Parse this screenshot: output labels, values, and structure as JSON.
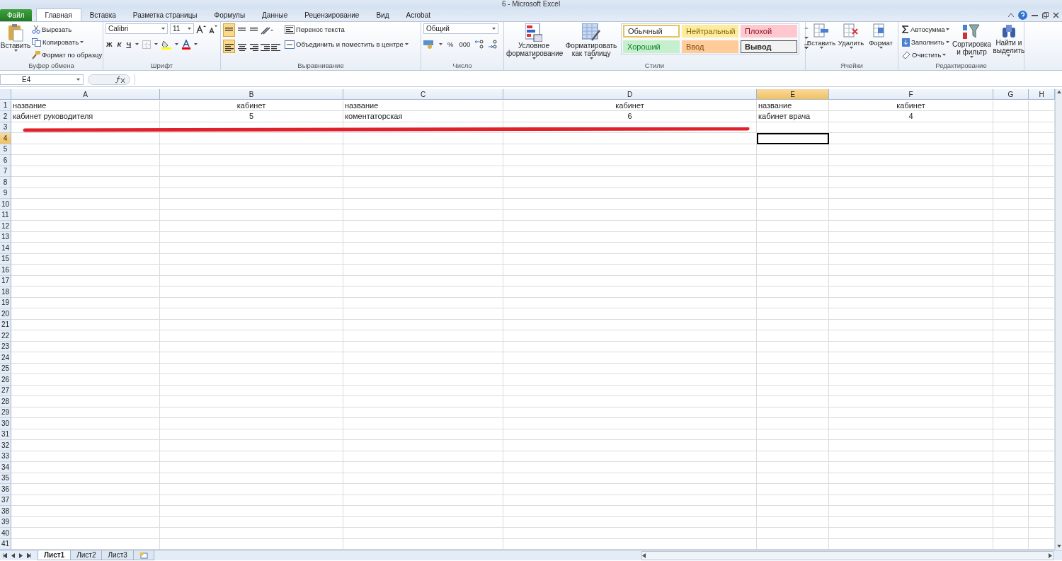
{
  "window": {
    "title": "6  -  Microsoft Excel"
  },
  "ribbon_tabs": [
    {
      "label": "Файл",
      "kind": "file",
      "selected": false
    },
    {
      "label": "Главная",
      "kind": "tab",
      "selected": true
    },
    {
      "label": "Вставка",
      "kind": "tab",
      "selected": false
    },
    {
      "label": "Разметка страницы",
      "kind": "tab",
      "selected": false
    },
    {
      "label": "Формулы",
      "kind": "tab",
      "selected": false
    },
    {
      "label": "Данные",
      "kind": "tab",
      "selected": false
    },
    {
      "label": "Рецензирование",
      "kind": "tab",
      "selected": false
    },
    {
      "label": "Вид",
      "kind": "tab",
      "selected": false
    },
    {
      "label": "Acrobat",
      "kind": "tab",
      "selected": false
    }
  ],
  "clipboard": {
    "paste": "Вставить",
    "cut": "Вырезать",
    "copy": "Копировать",
    "format_painter": "Формат по образцу",
    "label": "Буфер обмена"
  },
  "font": {
    "name": "Calibri",
    "size": "11",
    "bold": "Ж",
    "italic": "К",
    "underline": "Ч",
    "label": "Шрифт"
  },
  "alignment": {
    "vertical": [
      {
        "selected": true
      },
      {
        "selected": false
      },
      {
        "selected": false
      }
    ],
    "horizontal": [
      {
        "selected": true
      },
      {
        "selected": false
      },
      {
        "selected": false
      }
    ],
    "wrap": "Перенос текста",
    "merge": "Объединить и поместить в центре",
    "label": "Выравнивание"
  },
  "number": {
    "format": "Общий",
    "percent": "%",
    "thousands": "000",
    "label": "Число"
  },
  "styles": {
    "conditional": "Условное форматирование",
    "as_table": "Форматировать как таблицу",
    "presets": [
      {
        "label": "Обычный",
        "color": "#ffffff",
        "selected": true
      },
      {
        "label": "Нейтральный",
        "color": "#ffeb9c",
        "selected": false
      },
      {
        "label": "Плохой",
        "color": "#ffc7ce",
        "selected": false
      },
      {
        "label": "Хороший",
        "color": "#c6efce",
        "selected": false
      },
      {
        "label": "Ввод",
        "color": "#ffcc99",
        "selected": false
      },
      {
        "label": "Вывод",
        "color": "#f2f2f2",
        "selected": false
      }
    ],
    "label": "Стили"
  },
  "cells": {
    "buttons": [
      "Вставить",
      "Удалить",
      "Формат"
    ],
    "label": "Ячейки"
  },
  "editing": {
    "autosum": "Автосумма",
    "fill": "Заполнить",
    "clear": "Очистить",
    "sort": "Сортировка и фильтр",
    "find": "Найти и выделить",
    "label": "Редактирование"
  },
  "name_box": "E4",
  "columns": [
    {
      "label": "A",
      "selected": false
    },
    {
      "label": "B",
      "selected": false
    },
    {
      "label": "C",
      "selected": false
    },
    {
      "label": "D",
      "selected": false
    },
    {
      "label": "E",
      "selected": true
    },
    {
      "label": "F",
      "selected": false
    },
    {
      "label": "G",
      "selected": false
    },
    {
      "label": "H",
      "selected": false
    }
  ],
  "rows": [
    {
      "label": "1",
      "selected": false,
      "cells": [
        {
          "text": "название",
          "kind": "left"
        },
        {
          "text": "кабинет",
          "kind": "center"
        },
        {
          "text": "название",
          "kind": "left"
        },
        {
          "text": "кабинет",
          "kind": "center"
        },
        {
          "text": "название",
          "kind": "left"
        },
        {
          "text": "кабинет",
          "kind": "center"
        }
      ]
    },
    {
      "label": "2",
      "selected": false,
      "cells": [
        {
          "text": "кабинет руководителя",
          "kind": "left"
        },
        {
          "text": "5",
          "kind": "center"
        },
        {
          "text": "коментаторская",
          "kind": "left"
        },
        {
          "text": "6",
          "kind": "center"
        },
        {
          "text": "кабинет врача",
          "kind": "left"
        },
        {
          "text": "4",
          "kind": "center"
        }
      ]
    },
    {
      "label": "3",
      "selected": false
    },
    {
      "label": "4",
      "selected": true
    },
    {
      "label": "5",
      "selected": false
    },
    {
      "label": "6",
      "selected": false
    },
    {
      "label": "7",
      "selected": false
    },
    {
      "label": "8",
      "selected": false
    },
    {
      "label": "9",
      "selected": false
    },
    {
      "label": "10",
      "selected": false
    },
    {
      "label": "11",
      "selected": false
    },
    {
      "label": "12",
      "selected": false
    },
    {
      "label": "13",
      "selected": false
    },
    {
      "label": "14",
      "selected": false
    },
    {
      "label": "15",
      "selected": false
    },
    {
      "label": "16",
      "selected": false
    },
    {
      "label": "17",
      "selected": false
    },
    {
      "label": "18",
      "selected": false
    },
    {
      "label": "19",
      "selected": false
    },
    {
      "label": "20",
      "selected": false
    },
    {
      "label": "21",
      "selected": false
    },
    {
      "label": "22",
      "selected": false
    },
    {
      "label": "23",
      "selected": false
    },
    {
      "label": "24",
      "selected": false
    },
    {
      "label": "25",
      "selected": false
    },
    {
      "label": "26",
      "selected": false
    },
    {
      "label": "27",
      "selected": false
    },
    {
      "label": "28",
      "selected": false
    },
    {
      "label": "29",
      "selected": false
    },
    {
      "label": "30",
      "selected": false
    },
    {
      "label": "31",
      "selected": false
    },
    {
      "label": "32",
      "selected": false
    },
    {
      "label": "33",
      "selected": false
    },
    {
      "label": "34",
      "selected": false
    },
    {
      "label": "35",
      "selected": false
    },
    {
      "label": "36",
      "selected": false
    },
    {
      "label": "37",
      "selected": false
    },
    {
      "label": "38",
      "selected": false
    },
    {
      "label": "39",
      "selected": false
    },
    {
      "label": "40",
      "selected": false
    },
    {
      "label": "41",
      "selected": false
    }
  ],
  "sheets": [
    {
      "label": "Лист1",
      "selected": true
    },
    {
      "label": "Лист2",
      "selected": false
    },
    {
      "label": "Лист3",
      "selected": false
    }
  ]
}
